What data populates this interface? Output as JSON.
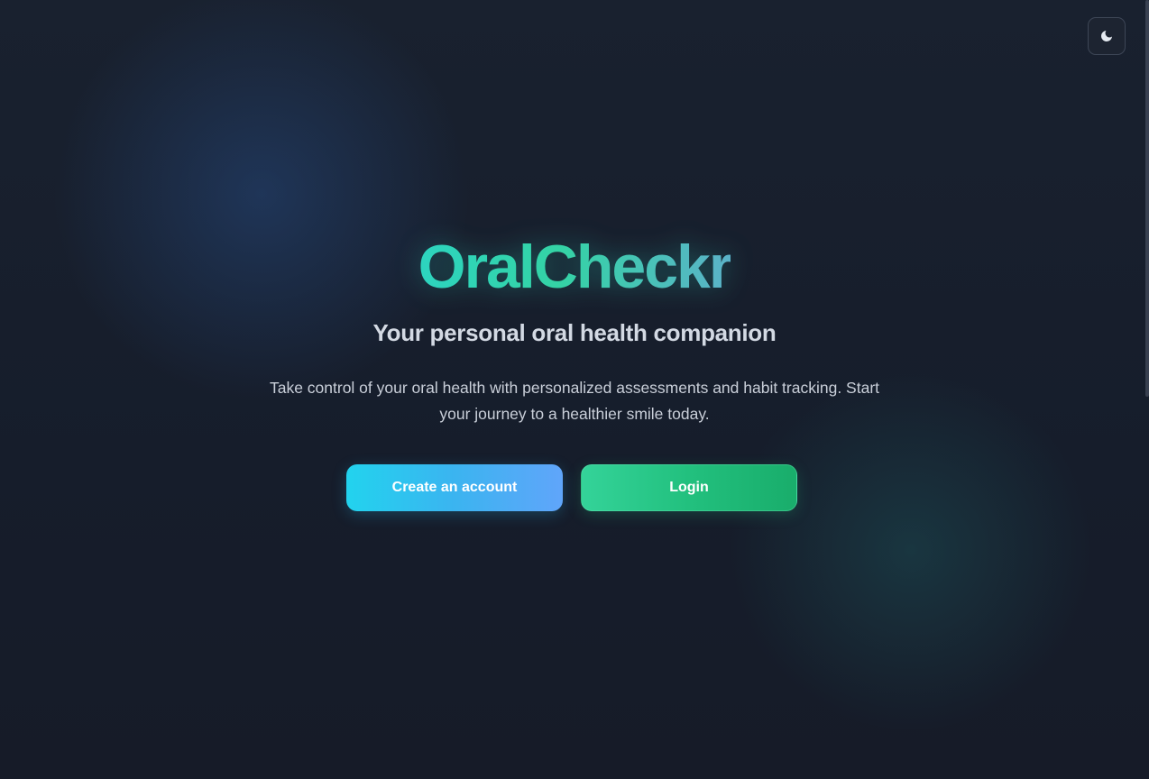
{
  "app": {
    "title": "OralCheckr",
    "tagline": "Your personal oral health companion",
    "description": "Take control of your oral health with personalized assessments and habit tracking. Start your journey to a healthier smile today."
  },
  "actions": {
    "create_account_label": "Create an account",
    "login_label": "Login"
  },
  "header": {
    "theme_toggle_icon": "moon-icon"
  },
  "colors": {
    "background": "#19212f",
    "title_gradient_start": "#2dd4bf",
    "title_gradient_end": "#5bb2c8",
    "create_button_start": "#22d3ee",
    "create_button_end": "#60a5fa",
    "login_button_start": "#34d399",
    "login_button_end": "#19ad6b",
    "subtitle_text": "#d3d9e3",
    "body_text": "#c9cfd9"
  }
}
